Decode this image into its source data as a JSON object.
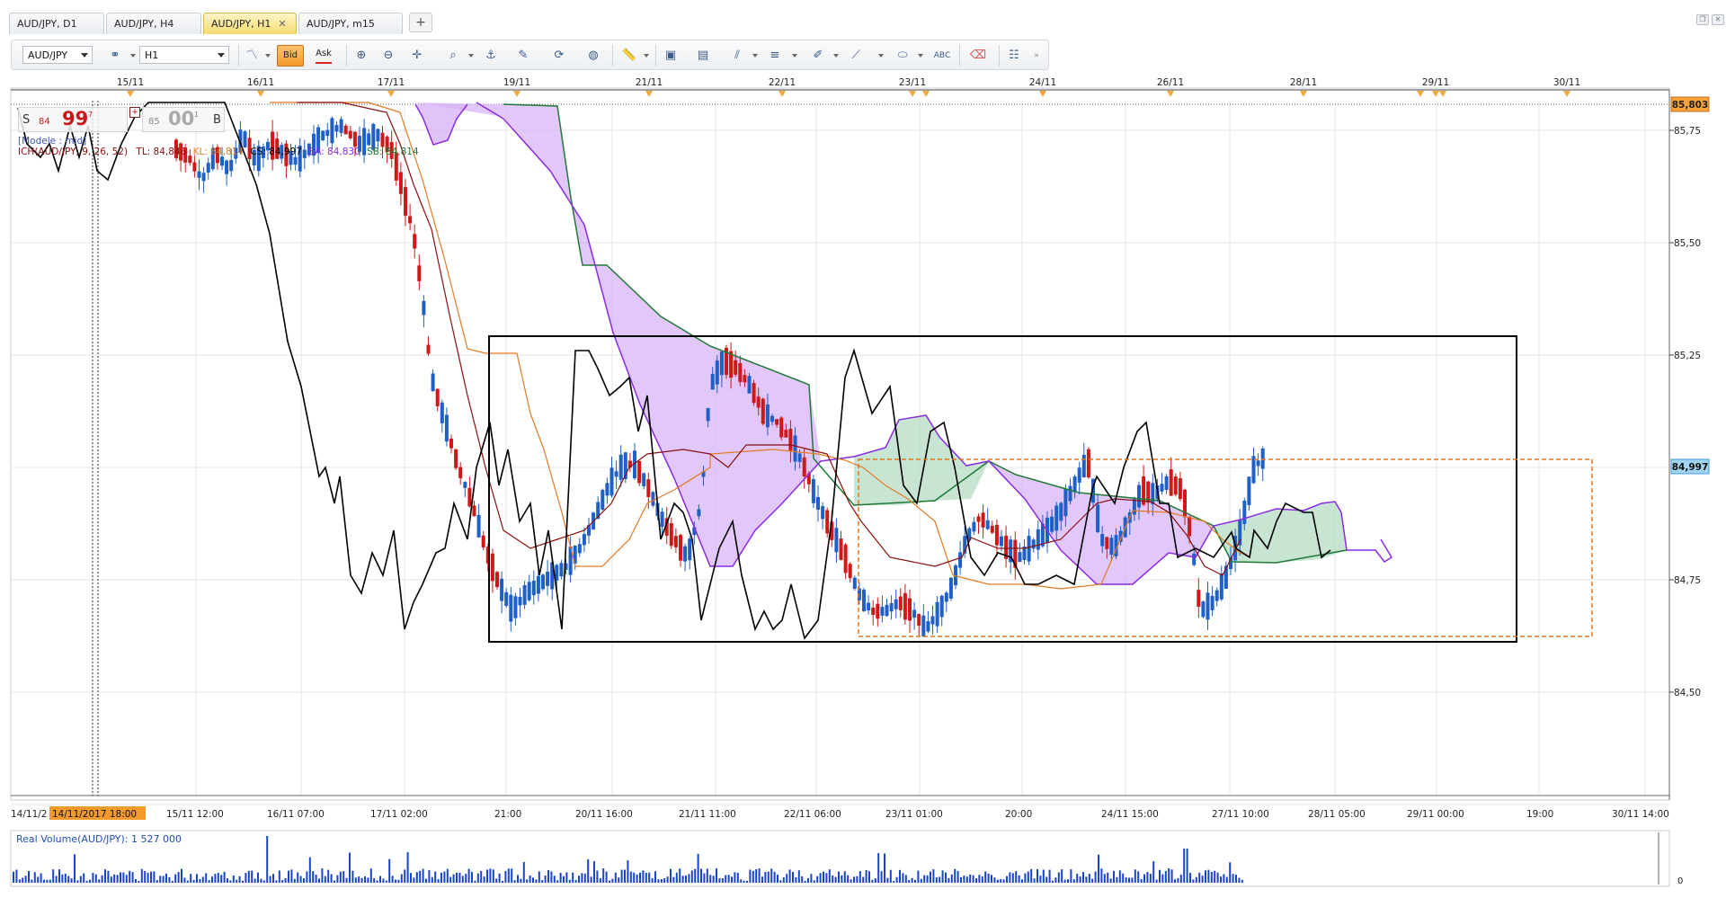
{
  "tabs": [
    {
      "label": "AUD/JPY, D1",
      "active": false
    },
    {
      "label": "AUD/JPY, H4",
      "active": false
    },
    {
      "label": "AUD/JPY, H1",
      "active": true
    },
    {
      "label": "AUD/JPY, m15",
      "active": false
    }
  ],
  "tab_add": "+",
  "tab_close": "✕",
  "toolbar": {
    "symbol": "AUD/JPY",
    "timeframe": "H1",
    "bid_label": "Bid",
    "ask_label": "Ask",
    "icons": [
      "indicator-icon",
      "link-icon",
      "chart-type-icon",
      "zoom-in-icon",
      "zoom-out-icon",
      "crosshair-icon",
      "zoom-rect-icon",
      "anchor-icon",
      "edit-icon",
      "rotate-icon",
      "globe-icon",
      "ruler-icon",
      "picture-icon",
      "template-icon",
      "fibonacci-icon",
      "lines-icon",
      "pencil-icon",
      "trendline-icon",
      "ellipse-icon",
      "text-icon",
      "eraser-icon",
      "objects-icon"
    ]
  },
  "trade_box": {
    "sell_label": "S",
    "sell_small": "84",
    "sell_big": "99",
    "sell_sup": "7",
    "buy_small": "85",
    "buy_big": "00",
    "buy_sup": "1",
    "buy_label": "B"
  },
  "info": {
    "model_line": "[Modele : mid]",
    "ich_line": "ICH(AUD/JPY, 9, 26, 52)",
    "tl": "TL: 84,846",
    "kl": "KL: 84,814",
    "cs": "CS: 84,997",
    "sa": "SA: 84,830",
    "sb": "SB: 84,814"
  },
  "colors": {
    "tenkan": "#e07a22",
    "kijun": "#8b0d0d",
    "chikou": "#000000",
    "span_a": "#8a2be2",
    "span_b": "#1f7a35",
    "kumo_bear": "#d8b4f8",
    "kumo_bull": "#b6dcc4",
    "candle_up": "#1f5fc8",
    "candle_down": "#d01818",
    "orange_box": "#e8741c",
    "price_tag_top": "#f7a23b",
    "price_tag_cur": "#9fd4f3",
    "volume": "#1a44c8"
  },
  "chart_data": {
    "type": "candlestick",
    "symbol": "AUD/JPY",
    "timeframe": "H1",
    "top_dates": [
      "15/11",
      "16/11",
      "17/11",
      "19/11",
      "21/11",
      "22/11",
      "23/11",
      "24/11",
      "26/11",
      "28/11",
      "29/11",
      "30/11"
    ],
    "x_labels": [
      "14/11/2",
      "14/11/2017 18:00",
      "15/11 12:00",
      "16/11 07:00",
      "17/11 02:00",
      "21:00",
      "20/11 16:00",
      "21/11 11:00",
      "22/11 06:00",
      "23/11 01:00",
      "20:00",
      "24/11 15:00",
      "27/11 10:00",
      "28/11 05:00",
      "29/11 00:00",
      "19:00",
      "30/11 14:00"
    ],
    "y_ticks": [
      "85,75",
      "85,50",
      "85,25",
      "84,75",
      "84,50"
    ],
    "ylim": [
      84.32,
      85.82
    ],
    "top_price_tag": "85,803",
    "current_price_tag": "84,997",
    "volume_label": "Real Volume(AUD/JPY): 1 527 000",
    "volume_axis_label": "0"
  }
}
